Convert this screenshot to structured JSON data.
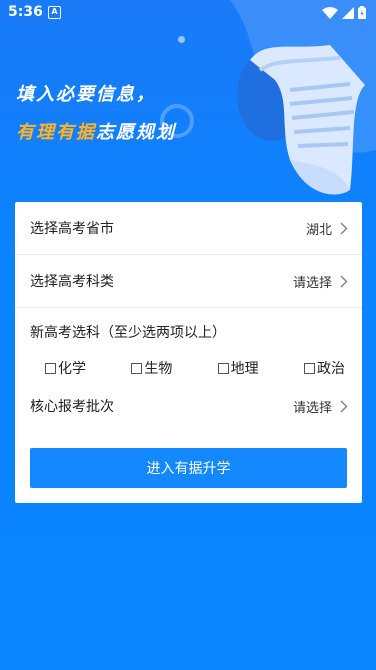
{
  "status_bar": {
    "time": "5:36",
    "notification_glyph": "A"
  },
  "hero": {
    "line1": "填入必要信息，",
    "line2_highlight": "有理有据",
    "line2_rest": "志愿规划"
  },
  "form": {
    "province": {
      "label": "选择高考省市",
      "value": "湖北"
    },
    "category": {
      "label": "选择高考科类",
      "value": "请选择"
    },
    "subjects": {
      "title": "新高考选科（至少选两项以上）",
      "options": [
        "化学",
        "生物",
        "地理",
        "政治"
      ]
    },
    "batch": {
      "label": "核心报考批次",
      "value": "请选择"
    },
    "submit_label": "进入有据升学"
  },
  "colors": {
    "background": "#0a84ff",
    "accent_orange": "#ffb428",
    "button": "#1388ff"
  }
}
